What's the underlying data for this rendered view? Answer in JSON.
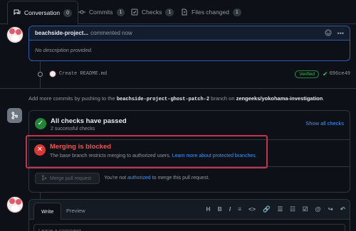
{
  "tabs": [
    {
      "label": "Conversation",
      "count": "0",
      "icon": "conversation-icon"
    },
    {
      "label": "Commits",
      "count": "1",
      "icon": "commits-icon"
    },
    {
      "label": "Checks",
      "count": "1",
      "icon": "checks-icon"
    },
    {
      "label": "Files changed",
      "count": "1",
      "icon": "files-icon"
    }
  ],
  "comment": {
    "author": "beachside-project...",
    "meta": "commented now",
    "body": "No description provided.",
    "menu_icon": "kebab-icon",
    "emoji_icon": "smiley-icon"
  },
  "commit": {
    "message": "Create README.md",
    "badge": "Verified",
    "sha": "696ce49"
  },
  "info": {
    "prefix": "Add more commits by pushing to the",
    "branch": "beachside-project-ghost-patch-2",
    "mid": "branch on",
    "repo": "zengeeks/yokohama-investigation",
    "suffix": "."
  },
  "checks": {
    "title": "All checks have passed",
    "subtitle": "2 successful checks",
    "show_all": "Show all checks"
  },
  "blocked": {
    "title": "Merging is blocked",
    "desc": "The base branch restricts merging to authorized users.",
    "link": "Learn more about protected branches."
  },
  "merge": {
    "button": "Merge pull request",
    "note_prefix": "You're not",
    "note_link": "authorized",
    "note_suffix": "to merge this pull request."
  },
  "editor": {
    "tab_write": "Write",
    "tab_preview": "Preview",
    "placeholder": "Leave a comment",
    "tools": [
      "H",
      "B",
      "I",
      "≡",
      "<>",
      "🔗",
      "☰",
      "☷",
      "☑",
      "@",
      "↪",
      "↶"
    ]
  },
  "colors": {
    "accent_blue": "#4493f8",
    "success": "#238636",
    "danger": "#da3633",
    "highlight_border": "#c7324a"
  }
}
